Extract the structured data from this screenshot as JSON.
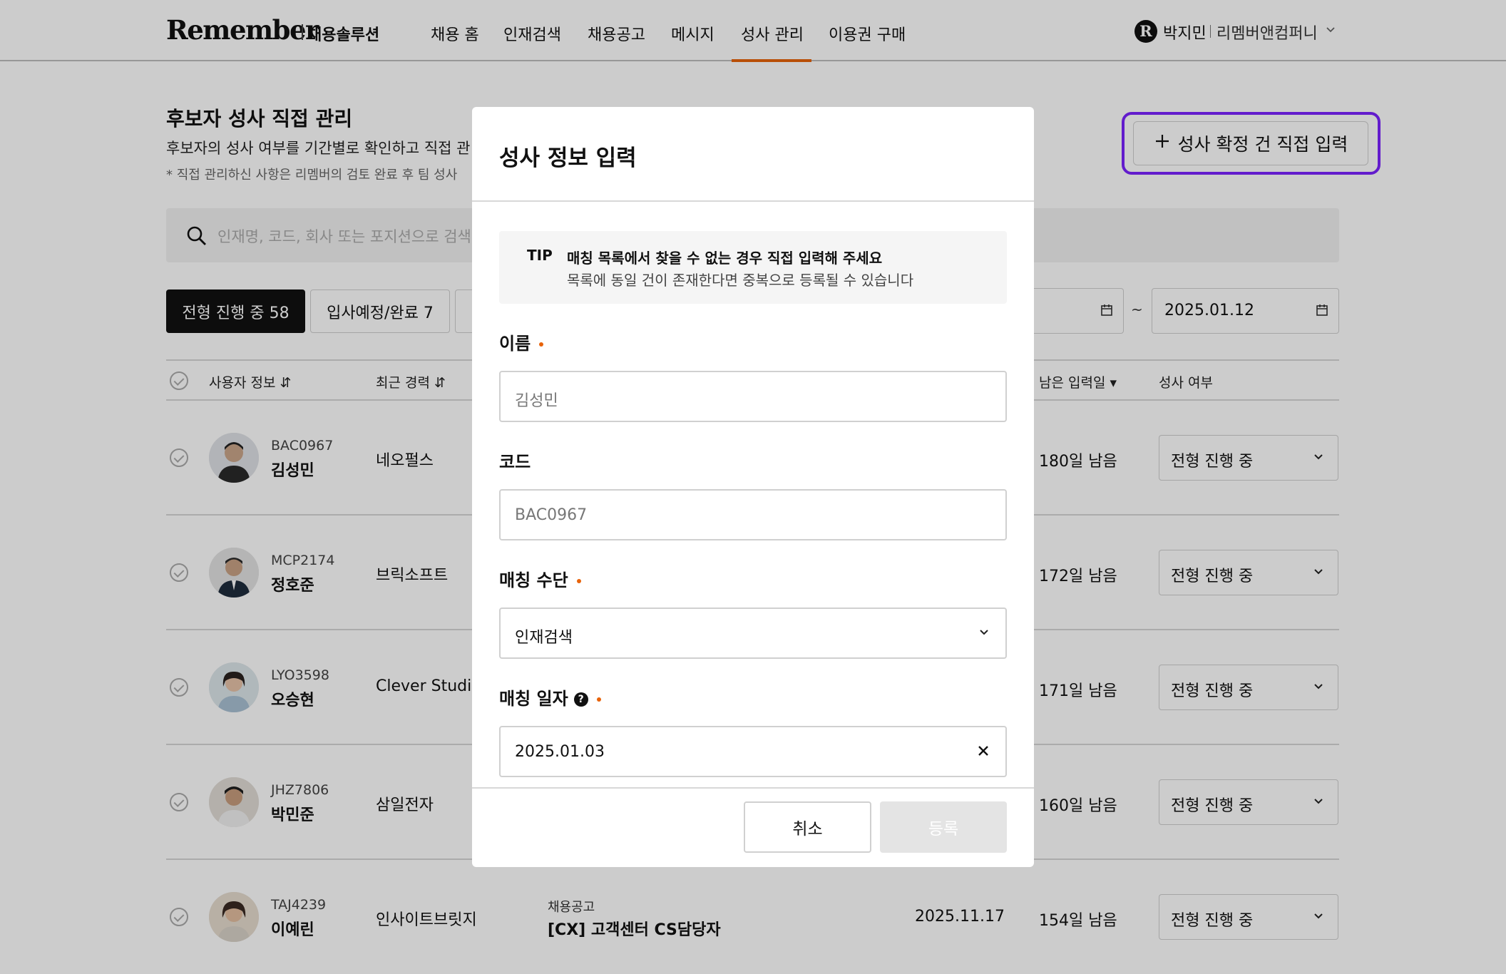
{
  "header": {
    "logo": "Remember",
    "logo_sub": "채용솔루션",
    "nav": [
      "채용 홈",
      "인재검색",
      "채용공고",
      "메시지",
      "성사 관리",
      "이용권 구매"
    ],
    "active_nav": "성사 관리",
    "user": {
      "initial": "R",
      "name": "박지민",
      "company": "리멤버앤컴퍼니"
    }
  },
  "page": {
    "title": "후보자 성사 직접 관리",
    "description": "후보자의 성사 여부를 기간별로 확인하고 직접 관",
    "note": "* 직접 관리하신 사항은 리멤버의 검토 완료 후 팀 성사",
    "direct_input_button": "성사 확정 건 직접 입력",
    "search_placeholder": "인재명, 코드, 회사 또는 포지션으로 검색",
    "tabs": [
      "전형 진행 중 58",
      "입사예정/완료 7"
    ],
    "date_end": "2025.01.12",
    "date_sep": "~"
  },
  "table": {
    "headers": {
      "user": "사용자 정보",
      "career": "최근 경력",
      "remaining": "남은 입력일",
      "status": "성사 여부"
    },
    "rows": [
      {
        "code": "BAC0967",
        "name": "김성민",
        "company": "네오펄스",
        "remaining": "180일 남음",
        "status": "전형 진행 중"
      },
      {
        "code": "MCP2174",
        "name": "정호준",
        "company": "브릭소프트",
        "remaining": "172일 남음",
        "status": "전형 진행 중"
      },
      {
        "code": "LYO3598",
        "name": "오승현",
        "company": "Clever Studio",
        "remaining": "171일 남음",
        "status": "전형 진행 중"
      },
      {
        "code": "JHZ7806",
        "name": "박민준",
        "company": "삼일전자",
        "remaining": "160일 남음",
        "status": "전형 진행 중"
      },
      {
        "code": "TAJ4239",
        "name": "이예린",
        "company": "인사이트브릿지",
        "job_label": "채용공고",
        "job_title": "[CX] 고객센터 CS담당자",
        "date": "2025.11.17",
        "remaining": "154일 남음",
        "status": "전형 진행 중"
      }
    ]
  },
  "modal": {
    "title": "성사 정보 입력",
    "tip_label": "TIP",
    "tip_main": "매칭 목록에서 찾을 수 없는 경우 직접 입력해 주세요",
    "tip_sub": "목록에 동일 건이 존재한다면 중복으로 등록될 수 있습니다",
    "name_label": "이름",
    "name_value": "김성민",
    "code_label": "코드",
    "code_value": "BAC0967",
    "method_label": "매칭 수단",
    "method_value": "인재검색",
    "date_label": "매칭 일자",
    "date_value": "2025.01.03",
    "cancel": "취소",
    "submit": "등록"
  },
  "colors": {
    "accent": "#e8630a",
    "focus_outline": "#7b22ff",
    "primary_dark": "#111111"
  }
}
